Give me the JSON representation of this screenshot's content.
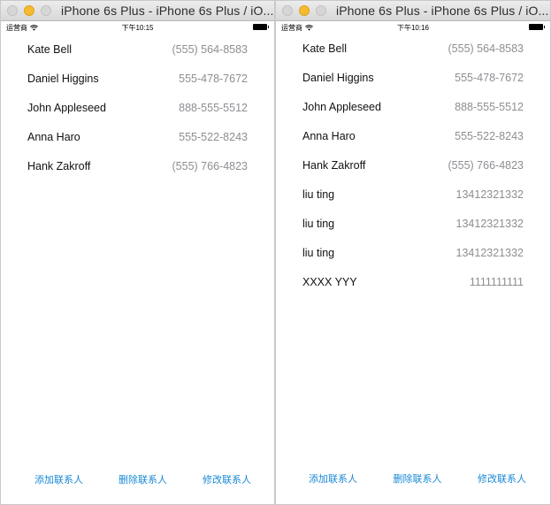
{
  "windows": [
    {
      "title": "iPhone 6s Plus - iPhone 6s Plus / iO...",
      "status": {
        "carrier": "运营商",
        "time": "下午10:15"
      },
      "contacts": [
        {
          "name": "Kate Bell",
          "phone": "(555) 564-8583"
        },
        {
          "name": "Daniel Higgins",
          "phone": "555-478-7672"
        },
        {
          "name": "John Appleseed",
          "phone": "888-555-5512"
        },
        {
          "name": "Anna Haro",
          "phone": "555-522-8243"
        },
        {
          "name": "Hank Zakroff",
          "phone": "(555) 766-4823"
        }
      ],
      "toolbar": {
        "add": "添加联系人",
        "delete": "删除联系人",
        "edit": "修改联系人"
      }
    },
    {
      "title": "iPhone 6s Plus - iPhone 6s Plus / iO...",
      "status": {
        "carrier": "运营商",
        "time": "下午10:16"
      },
      "contacts": [
        {
          "name": "Kate Bell",
          "phone": "(555) 564-8583"
        },
        {
          "name": "Daniel Higgins",
          "phone": "555-478-7672"
        },
        {
          "name": "John Appleseed",
          "phone": "888-555-5512"
        },
        {
          "name": "Anna Haro",
          "phone": "555-522-8243"
        },
        {
          "name": "Hank Zakroff",
          "phone": "(555) 766-4823"
        },
        {
          "name": "liu ting",
          "phone": "13412321332"
        },
        {
          "name": "liu ting",
          "phone": "13412321332"
        },
        {
          "name": "liu ting",
          "phone": "13412321332"
        },
        {
          "name": "XXXX YYY",
          "phone": "1111111111"
        }
      ],
      "toolbar": {
        "add": "添加联系人",
        "delete": "删除联系人",
        "edit": "修改联系人"
      }
    }
  ],
  "colors": {
    "accent": "#1a8ad6",
    "phone_text": "#8e8e93",
    "minimize_button": "#f5bb2e"
  },
  "icons": [
    "close-icon",
    "minimize-icon",
    "maximize-icon",
    "wifi-icon",
    "battery-icon"
  ]
}
